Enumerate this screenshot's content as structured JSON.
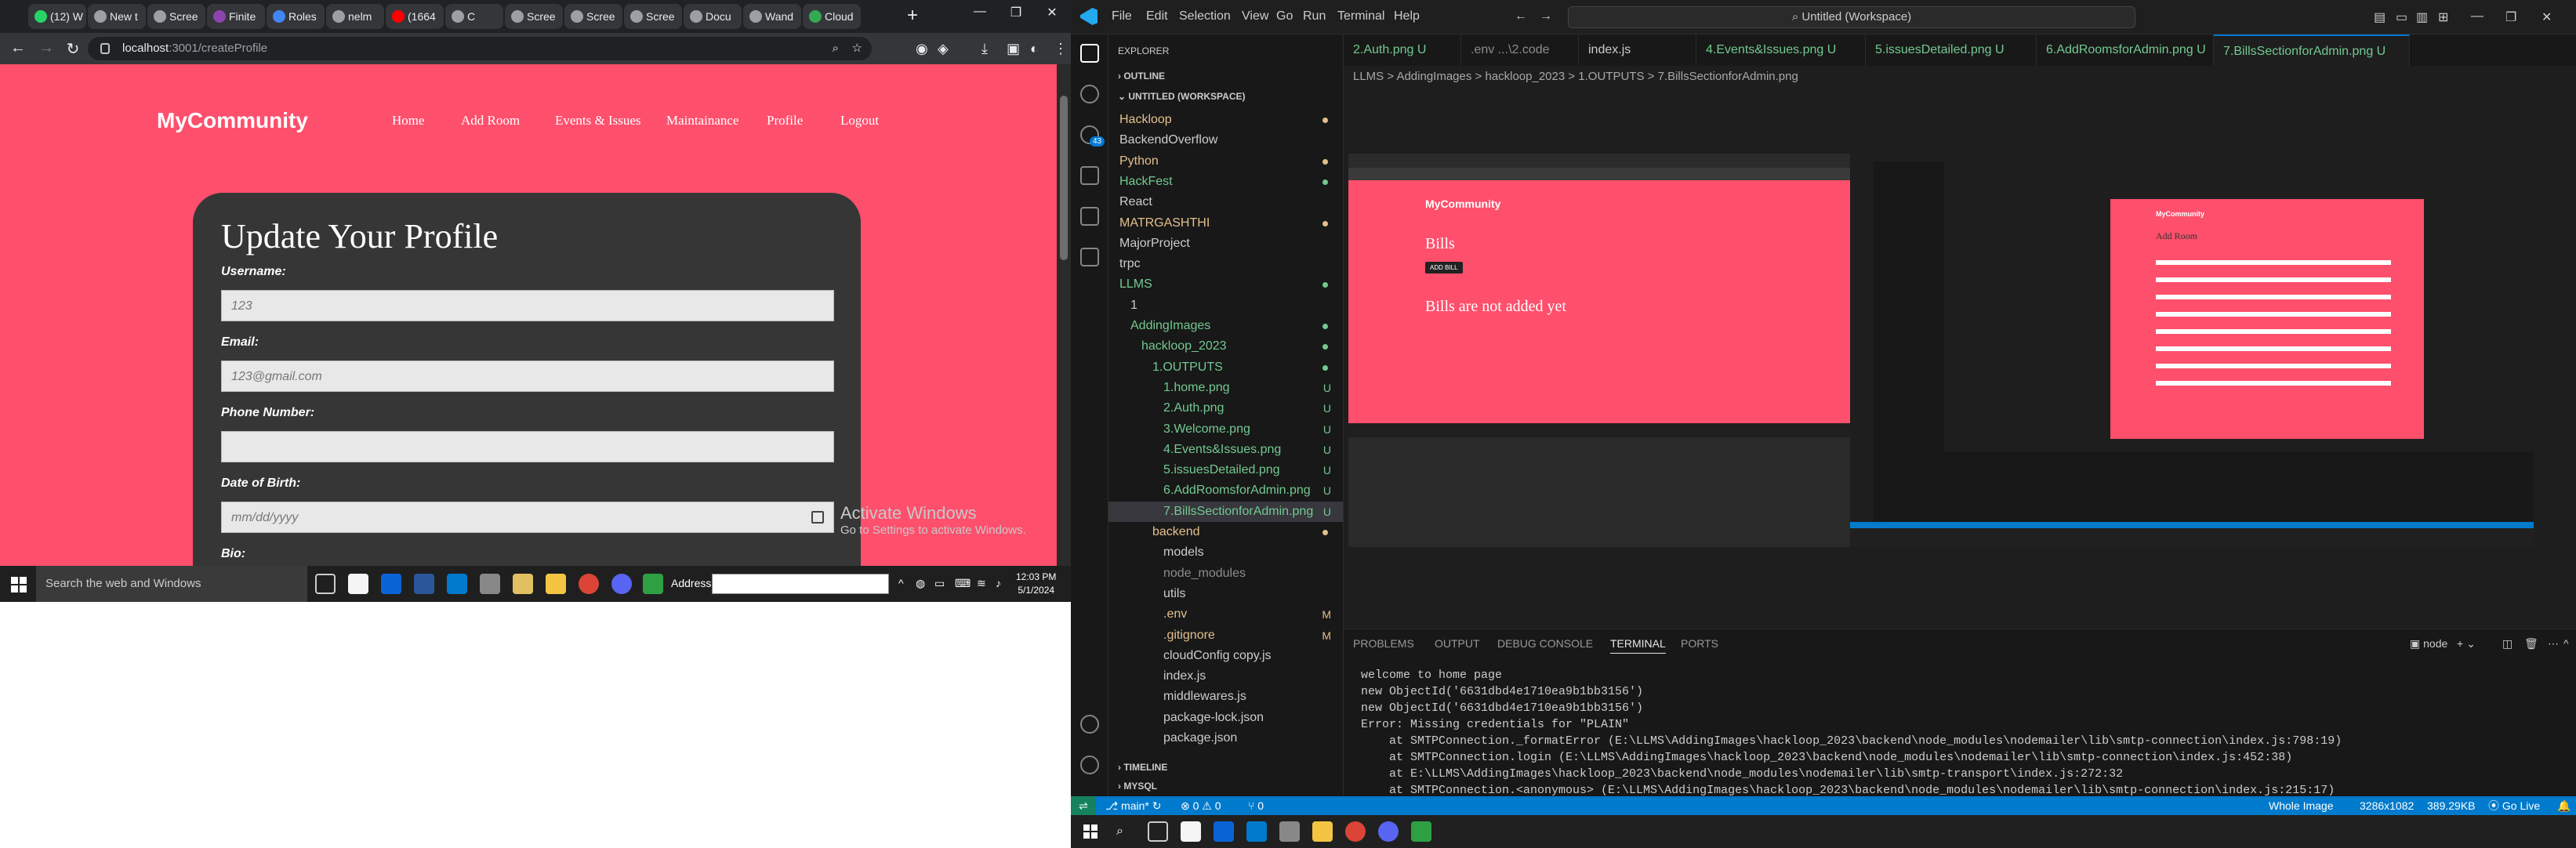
{
  "browser": {
    "tabs": [
      {
        "label": "(12) W",
        "icon": "whatsapp-icon",
        "color": "#25d366"
      },
      {
        "label": "New t",
        "icon": "chrome-icon",
        "color": "#9aa0a6"
      },
      {
        "label": "Scree",
        "icon": "github-icon",
        "color": "#9aa0a6"
      },
      {
        "label": "Finite",
        "icon": "book-icon",
        "color": "#8e44ad"
      },
      {
        "label": "Roles",
        "icon": "doc-icon",
        "color": "#4285f4"
      },
      {
        "label": "nelm",
        "icon": "github-icon",
        "color": "#9aa0a6"
      },
      {
        "label": "(1664",
        "icon": "youtube-icon",
        "color": "#ff0000"
      },
      {
        "label": "C",
        "icon": "chrome-icon",
        "color": "#9aa0a6"
      },
      {
        "label": "Scree",
        "icon": "github-icon",
        "color": "#9aa0a6"
      },
      {
        "label": "Scree",
        "icon": "github-icon",
        "color": "#9aa0a6"
      },
      {
        "label": "Scree",
        "icon": "github-icon",
        "color": "#9aa0a6"
      },
      {
        "label": "Docu",
        "icon": "github-icon",
        "color": "#9aa0a6"
      },
      {
        "label": "Wand",
        "icon": "github-icon",
        "color": "#9aa0a6"
      },
      {
        "label": "Cloud",
        "icon": "cloud-icon",
        "color": "#34a853"
      }
    ],
    "url_host": "localhost",
    "url_rest": ":3001/createProfile",
    "site": {
      "logo": "MyCommunity",
      "nav": [
        "Home",
        "Add Room",
        "Events & Issues",
        "Maintainance",
        "Profile",
        "Logout"
      ],
      "form_title": "Update Your Profile",
      "fields": [
        {
          "label": "Username:",
          "value": "123"
        },
        {
          "label": "Email:",
          "value": "123@gmail.com"
        },
        {
          "label": "Phone Number:",
          "value": ""
        },
        {
          "label": "Date of Birth:",
          "value": "mm/dd/yyyy"
        },
        {
          "label": "Bio:",
          "value": ""
        }
      ]
    },
    "watermark": {
      "line1": "Activate Windows",
      "line2": "Go to Settings to activate Windows."
    },
    "taskbar": {
      "search_placeholder": "Search the web and Windows",
      "address_label": "Address",
      "time": "12:03 PM",
      "date": "5/1/2024"
    }
  },
  "vscode": {
    "menus": [
      "File",
      "Edit",
      "Selection",
      "View",
      "Go",
      "Run",
      "Terminal",
      "Help"
    ],
    "command_center": "Untitled (Workspace)",
    "explorer_title": "EXPLORER",
    "outline": "OUTLINE",
    "workspace": "UNTITLED (WORKSPACE)",
    "tree": [
      {
        "label": "Hackloop",
        "depth": 0,
        "color": "#e2c08d",
        "dot": true,
        "sel": false
      },
      {
        "label": "BackendOverflow",
        "depth": 0,
        "color": "#cccccc",
        "dot": false,
        "sel": false
      },
      {
        "label": "Python",
        "depth": 0,
        "color": "#e2c08d",
        "dot": true,
        "sel": false
      },
      {
        "label": "HackFest",
        "depth": 0,
        "color": "#73c991",
        "dot": true,
        "sel": false
      },
      {
        "label": "React",
        "depth": 0,
        "color": "#cccccc",
        "dot": false,
        "sel": false
      },
      {
        "label": "MATRGASHTHI",
        "depth": 0,
        "color": "#e2c08d",
        "dot": true,
        "sel": false
      },
      {
        "label": "MajorProject",
        "depth": 0,
        "color": "#cccccc",
        "dot": false,
        "sel": false
      },
      {
        "label": "trpc",
        "depth": 0,
        "color": "#cccccc",
        "dot": false,
        "sel": false
      },
      {
        "label": "LLMS",
        "depth": 0,
        "color": "#73c991",
        "dot": true,
        "sel": false
      },
      {
        "label": "1",
        "depth": 1,
        "color": "#cccccc",
        "dot": false,
        "sel": false
      },
      {
        "label": "AddingImages",
        "depth": 1,
        "color": "#73c991",
        "dot": true,
        "sel": false
      },
      {
        "label": "hackloop_2023",
        "depth": 2,
        "color": "#73c991",
        "dot": true,
        "sel": false
      },
      {
        "label": "1.OUTPUTS",
        "depth": 3,
        "color": "#73c991",
        "dot": true,
        "sel": false
      },
      {
        "label": "1.home.png",
        "depth": 4,
        "color": "#73c991",
        "badge": "U",
        "sel": false
      },
      {
        "label": "2.Auth.png",
        "depth": 4,
        "color": "#73c991",
        "badge": "U",
        "sel": false
      },
      {
        "label": "3.Welcome.png",
        "depth": 4,
        "color": "#73c991",
        "badge": "U",
        "sel": false
      },
      {
        "label": "4.Events&Issues.png",
        "depth": 4,
        "color": "#73c991",
        "badge": "U",
        "sel": false
      },
      {
        "label": "5.issuesDetailed.png",
        "depth": 4,
        "color": "#73c991",
        "badge": "U",
        "sel": false
      },
      {
        "label": "6.AddRoomsforAdmin.png",
        "depth": 4,
        "color": "#73c991",
        "badge": "U",
        "sel": false
      },
      {
        "label": "7.BillsSectionforAdmin.png",
        "depth": 4,
        "color": "#73c991",
        "badge": "U",
        "sel": true
      },
      {
        "label": "backend",
        "depth": 3,
        "color": "#e2c08d",
        "dot": true,
        "sel": false
      },
      {
        "label": "models",
        "depth": 4,
        "color": "#cccccc",
        "dot": false,
        "sel": false
      },
      {
        "label": "node_modules",
        "depth": 4,
        "color": "#8c8c8c",
        "dot": false,
        "sel": false
      },
      {
        "label": "utils",
        "depth": 4,
        "color": "#cccccc",
        "dot": false,
        "sel": false
      },
      {
        "label": ".env",
        "depth": 4,
        "color": "#e2c08d",
        "badge": "M",
        "sel": false
      },
      {
        "label": ".gitignore",
        "depth": 4,
        "color": "#e2c08d",
        "badge": "M",
        "sel": false
      },
      {
        "label": "cloudConfig copy.js",
        "depth": 4,
        "color": "#cccccc",
        "dot": false,
        "sel": false
      },
      {
        "label": "index.js",
        "depth": 4,
        "color": "#cccccc",
        "dot": false,
        "sel": false
      },
      {
        "label": "middlewares.js",
        "depth": 4,
        "color": "#cccccc",
        "dot": false,
        "sel": false
      },
      {
        "label": "package-lock.json",
        "depth": 4,
        "color": "#cccccc",
        "dot": false,
        "sel": false
      },
      {
        "label": "package.json",
        "depth": 4,
        "color": "#cccccc",
        "dot": false,
        "sel": false
      }
    ],
    "timeline": "TIMELINE",
    "mysql": "MYSQL",
    "editor_tabs": [
      {
        "label": "2.Auth.png U",
        "color": "#73c991",
        "active": false
      },
      {
        "label": ".env ...\\2.code",
        "color": "#8c8c8c",
        "active": false
      },
      {
        "label": "index.js",
        "color": "#cccccc",
        "active": false
      },
      {
        "label": "4.Events&Issues.png U",
        "color": "#73c991",
        "active": false
      },
      {
        "label": "5.issuesDetailed.png U",
        "color": "#73c991",
        "active": false
      },
      {
        "label": "6.AddRoomsforAdmin.png U",
        "color": "#73c991",
        "active": false
      },
      {
        "label": "7.BillsSectionforAdmin.png U",
        "color": "#73c991",
        "active": true
      }
    ],
    "breadcrumbs": "LLMS  >  AddingImages  >  hackloop_2023  >  1.OUTPUTS  >  7.BillsSectionforAdmin.png",
    "preview": {
      "logo": "MyCommunity",
      "heading": "Bills",
      "button": "ADD BILL",
      "message": "Bills are not added yet",
      "inner_logo": "MyCommunity",
      "inner_heading": "Add Room"
    },
    "panel_tabs": [
      "PROBLEMS",
      "OUTPUT",
      "DEBUG CONSOLE",
      "TERMINAL",
      "PORTS"
    ],
    "terminal_shell": "node",
    "terminal_lines": [
      "welcome to home page",
      "new ObjectId('6631dbd4e1710ea9b1bb3156')",
      "new ObjectId('6631dbd4e1710ea9b1bb3156')",
      "Error: Missing credentials for \"PLAIN\"",
      "    at SMTPConnection._formatError (E:\\LLMS\\AddingImages\\hackloop_2023\\backend\\node_modules\\nodemailer\\lib\\smtp-connection\\index.js:798:19)",
      "    at SMTPConnection.login (E:\\LLMS\\AddingImages\\hackloop_2023\\backend\\node_modules\\nodemailer\\lib\\smtp-connection\\index.js:452:38)",
      "    at E:\\LLMS\\AddingImages\\hackloop_2023\\backend\\node_modules\\nodemailer\\lib\\smtp-transport\\index.js:272:32",
      "    at SMTPConnection.<anonymous> (E:\\LLMS\\AddingImages\\hackloop_2023\\backend\\node_modules\\nodemailer\\lib\\smtp-connection\\index.js:215:17)"
    ],
    "status": {
      "branch": "main*",
      "errors": "0",
      "warnings": "0",
      "ports": "0",
      "view": "Whole Image",
      "dims": "3286x1082",
      "size": "389.29KB",
      "golive": "Go Live"
    }
  },
  "colors": {
    "site_bg": "#fe4f6c",
    "card_bg": "#363636",
    "vscode_blue": "#007acc",
    "git_green": "#73c991",
    "git_mod": "#e2c08d"
  }
}
